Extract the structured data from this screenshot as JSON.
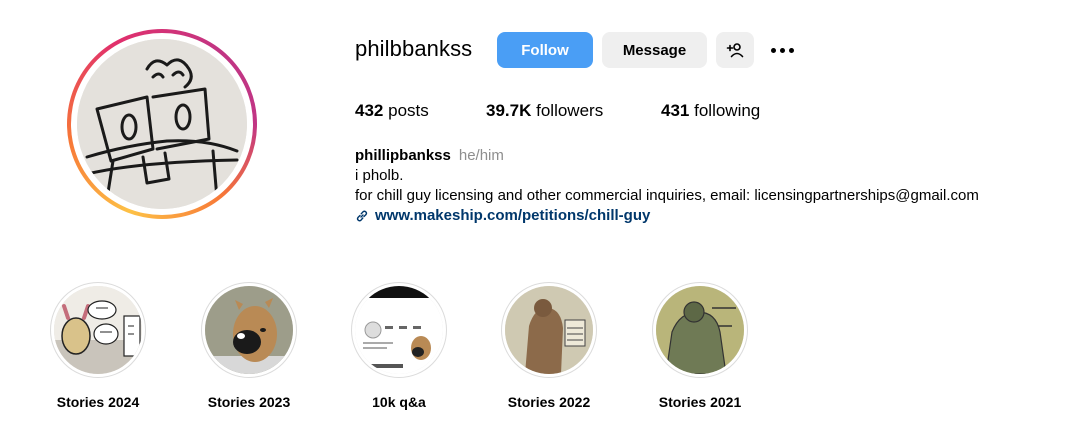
{
  "profile": {
    "username": "philbbankss",
    "follow_label": "Follow",
    "message_label": "Message",
    "add_user_icon": "add-user-icon",
    "more_icon": "more-options-icon",
    "follow_color": "#4a9ef5"
  },
  "stats": {
    "posts_count": "432",
    "posts_label": "posts",
    "followers_count": "39.7K",
    "followers_label": "followers",
    "following_count": "431",
    "following_label": "following"
  },
  "bio": {
    "name": "phillipbankss",
    "pronouns": "he/him",
    "line1": "i pholb.",
    "line2": "for chill guy licensing and other commercial inquiries, email:  licensingpartnerships@gmail.com",
    "link": "www.makeship.com/petitions/chill-guy",
    "link_icon": "link-icon",
    "link_color": "#00376b"
  },
  "highlights": [
    {
      "label": "Stories 2024"
    },
    {
      "label": "Stories 2023"
    },
    {
      "label": "10k q&a"
    },
    {
      "label": "Stories 2022"
    },
    {
      "label": "Stories 2021"
    }
  ]
}
